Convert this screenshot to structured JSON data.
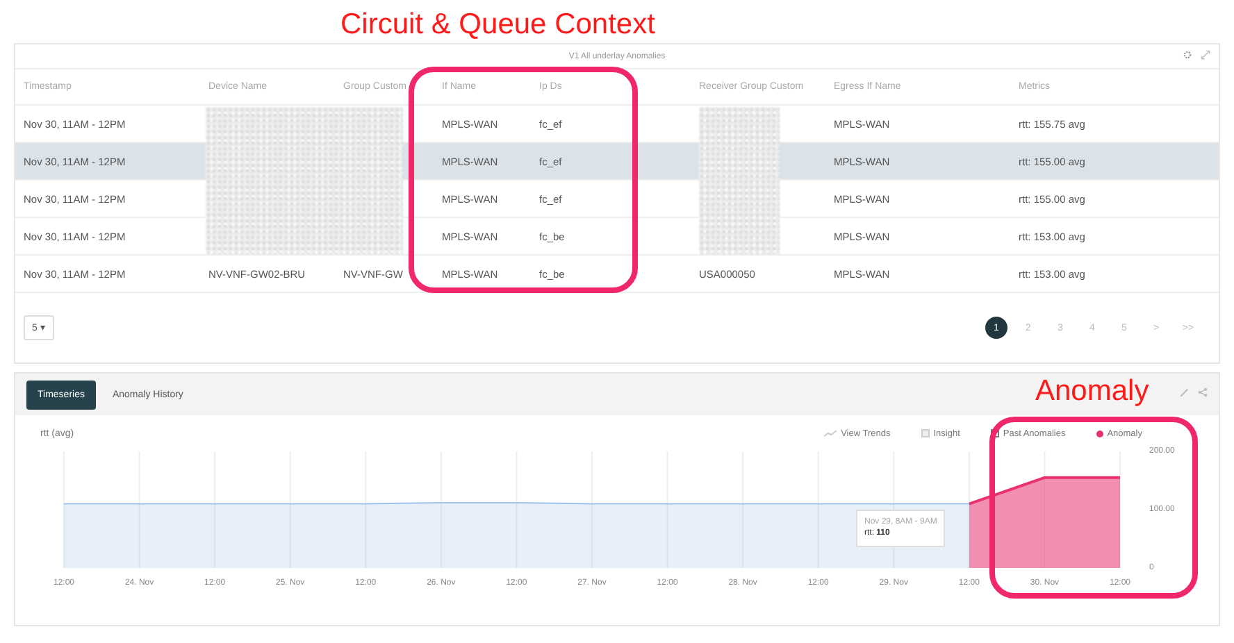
{
  "annotations": [
    {
      "text": "Circuit & Queue Context"
    },
    {
      "text": "Anomaly"
    }
  ],
  "table": {
    "title": "V1 All underlay Anomalies",
    "columns": [
      "Timestamp",
      "Device Name",
      "Group Custom",
      "If Name",
      "Ip Ds",
      "Receiver Group Custom",
      "Egress If Name",
      "Metrics"
    ],
    "rows": [
      {
        "selected": false,
        "cells": [
          "Nov 30, 11AM - 12PM",
          "",
          "",
          "MPLS-WAN",
          "fc_ef",
          "",
          "MPLS-WAN",
          "rtt: 155.75 avg"
        ]
      },
      {
        "selected": true,
        "cells": [
          "Nov 30, 11AM - 12PM",
          "",
          "",
          "MPLS-WAN",
          "fc_ef",
          "",
          "MPLS-WAN",
          "rtt: 155.00 avg"
        ]
      },
      {
        "selected": false,
        "cells": [
          "Nov 30, 11AM - 12PM",
          "",
          "",
          "MPLS-WAN",
          "fc_ef",
          "",
          "MPLS-WAN",
          "rtt: 155.00 avg"
        ]
      },
      {
        "selected": false,
        "cells": [
          "Nov 30, 11AM - 12PM",
          "",
          "",
          "MPLS-WAN",
          "fc_be",
          "",
          "MPLS-WAN",
          "rtt: 153.00 avg"
        ]
      },
      {
        "selected": false,
        "cells": [
          "Nov 30, 11AM - 12PM",
          "NV-VNF-GW02-BRU",
          "NV-VNF-GW",
          "MPLS-WAN",
          "fc_be",
          "USA000050",
          "MPLS-WAN",
          "rtt: 153.00 avg"
        ]
      }
    ],
    "page_size": "5 ▾",
    "pages": [
      {
        "label": "1",
        "selected": true
      },
      {
        "label": "2",
        "selected": false
      },
      {
        "label": "3",
        "selected": false
      },
      {
        "label": "4",
        "selected": false
      },
      {
        "label": "5",
        "selected": false
      },
      {
        "label": ">",
        "selected": false
      },
      {
        "label": ">>",
        "selected": false
      }
    ]
  },
  "chart_panel": {
    "tabs": [
      {
        "label": "Timeseries",
        "selected": true
      },
      {
        "label": "Anomaly History",
        "selected": false
      }
    ],
    "legend": [
      {
        "kind": "trend",
        "label": "View Trends"
      },
      {
        "kind": "box",
        "label": "Insight"
      },
      {
        "kind": "checkbox",
        "label": "Past Anomalies",
        "checked": true
      }
    ],
    "tooltip": {
      "title": "Nov 29, 8AM - 9AM",
      "value": "rtt: **110**"
    },
    "chart_data": {
      "type": "area",
      "ylabel": "rtt (avg)",
      "grid": true,
      "categories": [
        "12:00",
        "24. Nov",
        "12:00",
        "25. Nov",
        "12:00",
        "26. Nov",
        "12:00",
        "27. Nov",
        "12:00",
        "28. Nov",
        "12:00",
        "29. Nov",
        "12:00",
        "30. Nov",
        "12:00"
      ],
      "series": [
        {
          "color": "#9fc3e8",
          "values": [
            110,
            110,
            110,
            110,
            110,
            112,
            112,
            110,
            110,
            110,
            110,
            110,
            110,
            null,
            null
          ]
        },
        {
          "name": "Anomaly",
          "color": "#e8336f",
          "values": [
            null,
            null,
            null,
            null,
            null,
            null,
            null,
            null,
            null,
            null,
            null,
            null,
            110,
            155,
            155
          ]
        }
      ],
      "ylim": [
        0,
        200
      ],
      "yticks": [
        {
          "value": 0,
          "label": "0"
        },
        {
          "value": 100,
          "label": "100.00"
        },
        {
          "value": 200,
          "label": "200.00"
        }
      ]
    }
  }
}
